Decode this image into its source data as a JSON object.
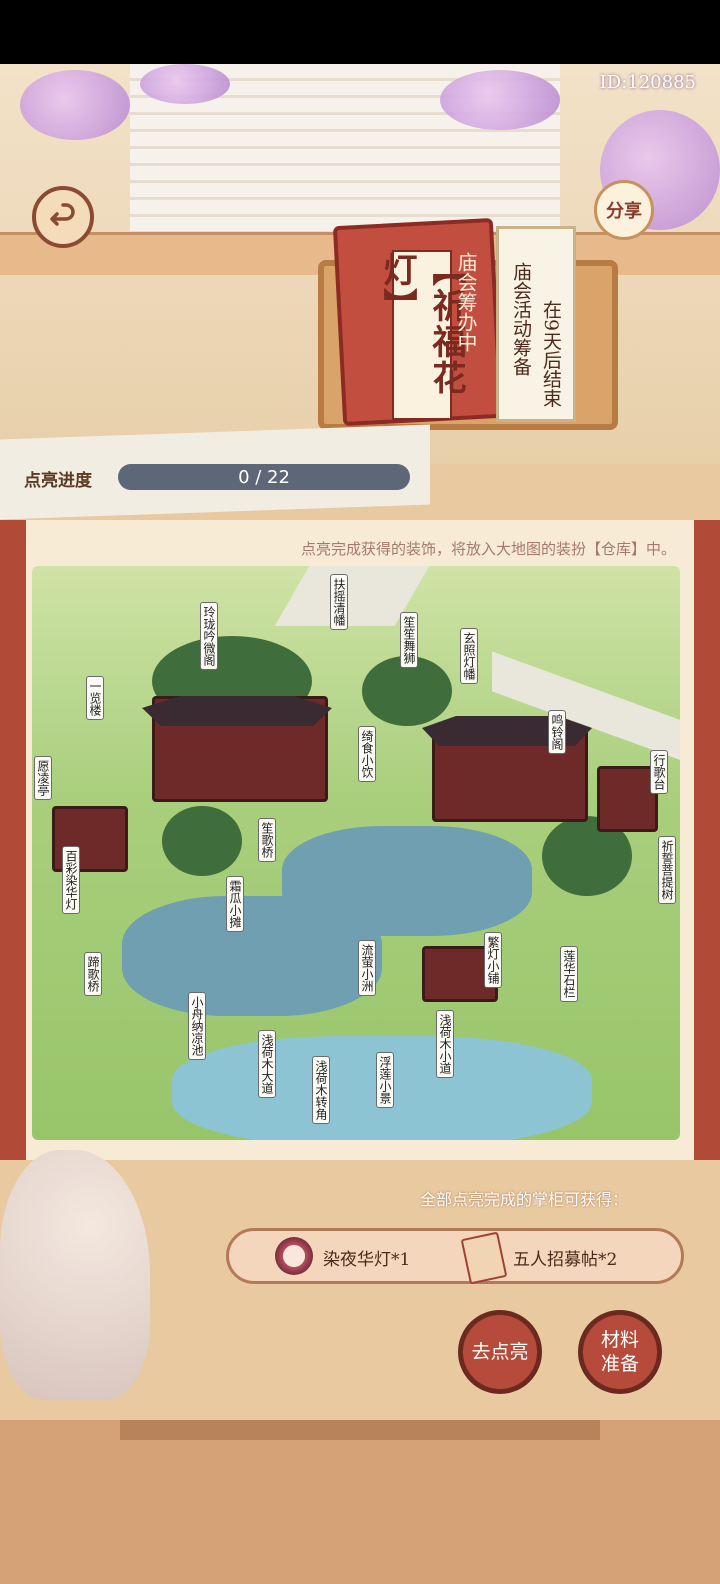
{
  "player": {
    "id": "ID:120885"
  },
  "header": {
    "share_label": "分享"
  },
  "book": {
    "title": "【祈福花灯】",
    "status": "庙会筹办中",
    "activity": "庙会活动筹备",
    "countdown": "在9天后结束"
  },
  "progress": {
    "label": "点亮进度",
    "current": 0,
    "total": 22,
    "text": "0 / 22"
  },
  "scroll": {
    "hint": "点亮完成获得的装饰，将放入大地图的装扮【仓库】中。"
  },
  "map_tags": [
    "扶摇清幡",
    "玲珑吟微阁",
    "笙笙舞狮",
    "玄照灯幡",
    "一览楼",
    "鸣铃阁",
    "绮食小饮",
    "行歌台",
    "愿凌亭",
    "笙歌桥",
    "百彩染华灯",
    "祈誓菩提树",
    "霜瓜小摊",
    "蹄歌桥",
    "流萤小洲",
    "莲华石栏",
    "繁灯小铺",
    "小舟纳凉池",
    "浅荷木大道",
    "浮莲小景",
    "浅荷木小道",
    "浅荷木转角"
  ],
  "rewards": {
    "title": "全部点亮完成的掌柜可获得：",
    "items": [
      {
        "label": "染夜华灯*1",
        "icon": "lantern-wreath-icon"
      },
      {
        "label": "五人招募帖*2",
        "icon": "recruit-cards-icon"
      }
    ]
  },
  "actions": {
    "light_up": "去点亮",
    "materials": "材料准备"
  },
  "colors": {
    "accent_red": "#b14a36",
    "progress_bar": "#5d6777",
    "map_green": "#a9cf7d"
  }
}
